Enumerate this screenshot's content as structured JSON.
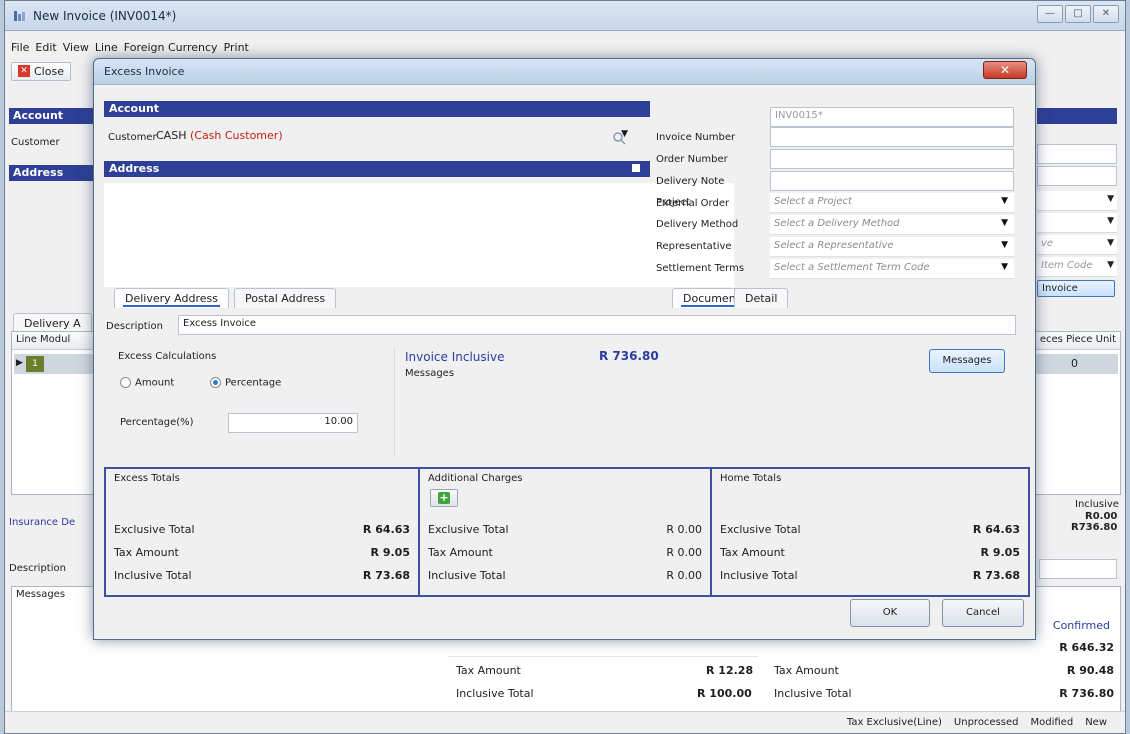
{
  "outer": {
    "title": "New Invoice (INV0014*)",
    "menu": [
      "File",
      "Edit",
      "View",
      "Line",
      "Foreign Currency",
      "Print"
    ],
    "close_label": "Close",
    "account_bar": "Account",
    "customer_label": "Customer",
    "address_bar": "Address",
    "delivery_tab": "Delivery A",
    "grid_header": "Line  Modul",
    "grid_row_num": "1",
    "right_col_header": "eces  Piece Unit",
    "right_col_value": "0",
    "right_selects": [
      "ve",
      "Item Code"
    ],
    "invoice_btn": "Invoice",
    "insurance_label": "Insurance De",
    "description_label": "Description",
    "inclusive_header": "Inclusive",
    "inclusive_v1": "R0.00",
    "inclusive_v2": "R736.80",
    "messages_label": "Messages",
    "confirmed": "Confirmed",
    "right_totals": [
      "R 646.32",
      "R 90.48",
      "R 736.80"
    ],
    "mid_tax_label": "Tax Amount",
    "mid_tax_value": "R 12.28",
    "mid_incl_label": "Inclusive Total",
    "mid_incl_value": "R 100.00",
    "rt_tax_label": "Tax Amount",
    "rt_incl_label": "Inclusive Total",
    "status": [
      "Tax Exclusive(Line)",
      "Unprocessed",
      "Modified",
      "New"
    ]
  },
  "modal": {
    "title": "Excess Invoice",
    "account_bar": "Account",
    "customer_label": "Customer",
    "customer_code": "CASH",
    "customer_name": "(Cash Customer)",
    "address_bar": "Address",
    "tabs_address": [
      "Delivery Address",
      "Postal Address"
    ],
    "fields": {
      "invoice_number_label": "Invoice Number",
      "invoice_number_value": "INV0015*",
      "order_number_label": "Order Number",
      "delivery_note_label": "Delivery Note",
      "external_order_label": "External Order",
      "project_label": "Project",
      "project_ph": "Select a Project",
      "delivery_method_label": "Delivery Method",
      "delivery_method_ph": "Select a Delivery Method",
      "representative_label": "Representative",
      "representative_ph": "Select a Representative",
      "settlement_label": "Settlement Terms",
      "settlement_ph": "Select a Settlement Term Code"
    },
    "tabs_doc": [
      "Document",
      "Detail"
    ],
    "description_label": "Description",
    "description_value": "Excess Invoice",
    "excess_calc_label": "Excess Calculations",
    "radio_amount": "Amount",
    "radio_percentage": "Percentage",
    "percentage_label": "Percentage(%)",
    "percentage_value": "10.00",
    "invoice_inclusive_label": "Invoice Inclusive",
    "invoice_inclusive_value": "R 736.80",
    "messages_label": "Messages",
    "messages_btn": "Messages",
    "excess_totals": {
      "title": "Excess Totals",
      "rows": [
        {
          "label": "Exclusive Total",
          "value": "R 64.63"
        },
        {
          "label": "Tax Amount",
          "value": "R 9.05"
        },
        {
          "label": "Inclusive Total",
          "value": "R 73.68"
        }
      ]
    },
    "additional_charges": {
      "title": "Additional Charges",
      "rows": [
        {
          "label": "Exclusive Total",
          "value": "R 0.00"
        },
        {
          "label": "Tax Amount",
          "value": "R 0.00"
        },
        {
          "label": "Inclusive Total",
          "value": "R 0.00"
        }
      ]
    },
    "home_totals": {
      "title": "Home Totals",
      "rows": [
        {
          "label": "Exclusive Total",
          "value": "R 64.63"
        },
        {
          "label": "Tax Amount",
          "value": "R 9.05"
        },
        {
          "label": "Inclusive Total",
          "value": "R 73.68"
        }
      ]
    },
    "ok": "OK",
    "cancel": "Cancel"
  },
  "colors": {
    "header_bar": "#2d3f96",
    "accent_link": "#2a3da0",
    "customer_red": "#c41f12"
  }
}
